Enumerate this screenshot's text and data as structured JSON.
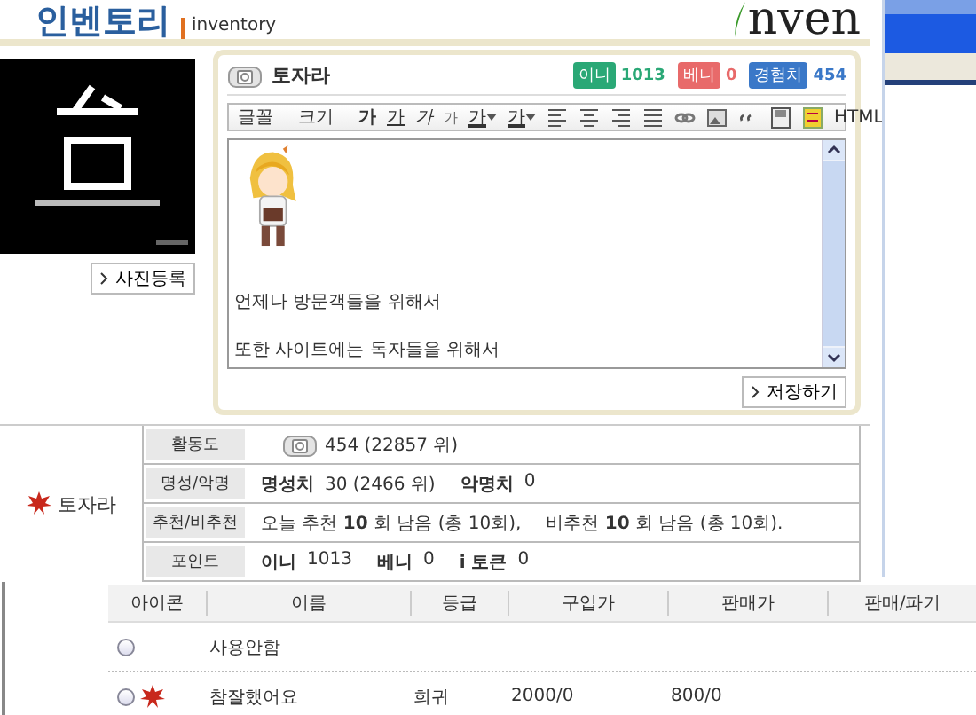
{
  "header": {
    "logo": "인벤토리",
    "subtitle": "inventory",
    "brand": "nven"
  },
  "profile": {
    "photo_button": "사진등록",
    "name": "토자라",
    "points": [
      {
        "label": "이니",
        "value": "1013",
        "color": "#2aa876"
      },
      {
        "label": "베니",
        "value": "0",
        "color": "#e86a6a"
      },
      {
        "label": "경험치",
        "value": "454",
        "color": "#3a78c8"
      }
    ],
    "toolbar": {
      "tools": [
        {
          "label": "글꼴",
          "kind": "menu"
        },
        {
          "label": "크기",
          "kind": "menu"
        },
        {
          "label": "가",
          "kind": "bold"
        },
        {
          "label": "가",
          "kind": "underline"
        },
        {
          "label": "가",
          "kind": "italic"
        },
        {
          "label": "가",
          "kind": "strike"
        },
        {
          "label": "가",
          "kind": "color"
        },
        {
          "label": "가",
          "kind": "highlight"
        }
      ],
      "html": "HTML"
    },
    "message": [
      "언제나 방문객들을 위해서",
      "또한 사이트에는 독자들을 위해서"
    ],
    "save_button": "저장하기"
  },
  "stats": {
    "name": "토자라",
    "rows": [
      {
        "label": "활동도",
        "kind": "activity",
        "text": "454 (22857 위)"
      },
      {
        "label": "명성/악명",
        "kind": "pairs",
        "pairs": [
          {
            "label": "명성치",
            "value": "30 (2466 위)"
          },
          {
            "label": "악명치",
            "value": "0"
          }
        ]
      },
      {
        "label": "추천/비추천",
        "kind": "sentences",
        "sentences": [
          "오늘 추천 **10** 회 남음 (총 10회),",
          "비추천 **10** 회 남음 (총 10회)."
        ]
      },
      {
        "label": "포인트",
        "kind": "pairs",
        "pairs": [
          {
            "label": "이니",
            "value": "1013"
          },
          {
            "label": "베니",
            "value": "0"
          },
          {
            "label": "i 토큰",
            "value": "0"
          }
        ]
      }
    ]
  },
  "items": {
    "columns": [
      "아이콘",
      "이름",
      "등급",
      "구입가",
      "판매가",
      "판매/파기"
    ],
    "rows": [
      {
        "kind": "none",
        "selected": false,
        "name": "사용안함"
      },
      {
        "kind": "badge",
        "selected": false,
        "name": "참잘했어요",
        "grade": "희귀",
        "buy": "2000/0",
        "sell": "800/0"
      }
    ]
  }
}
